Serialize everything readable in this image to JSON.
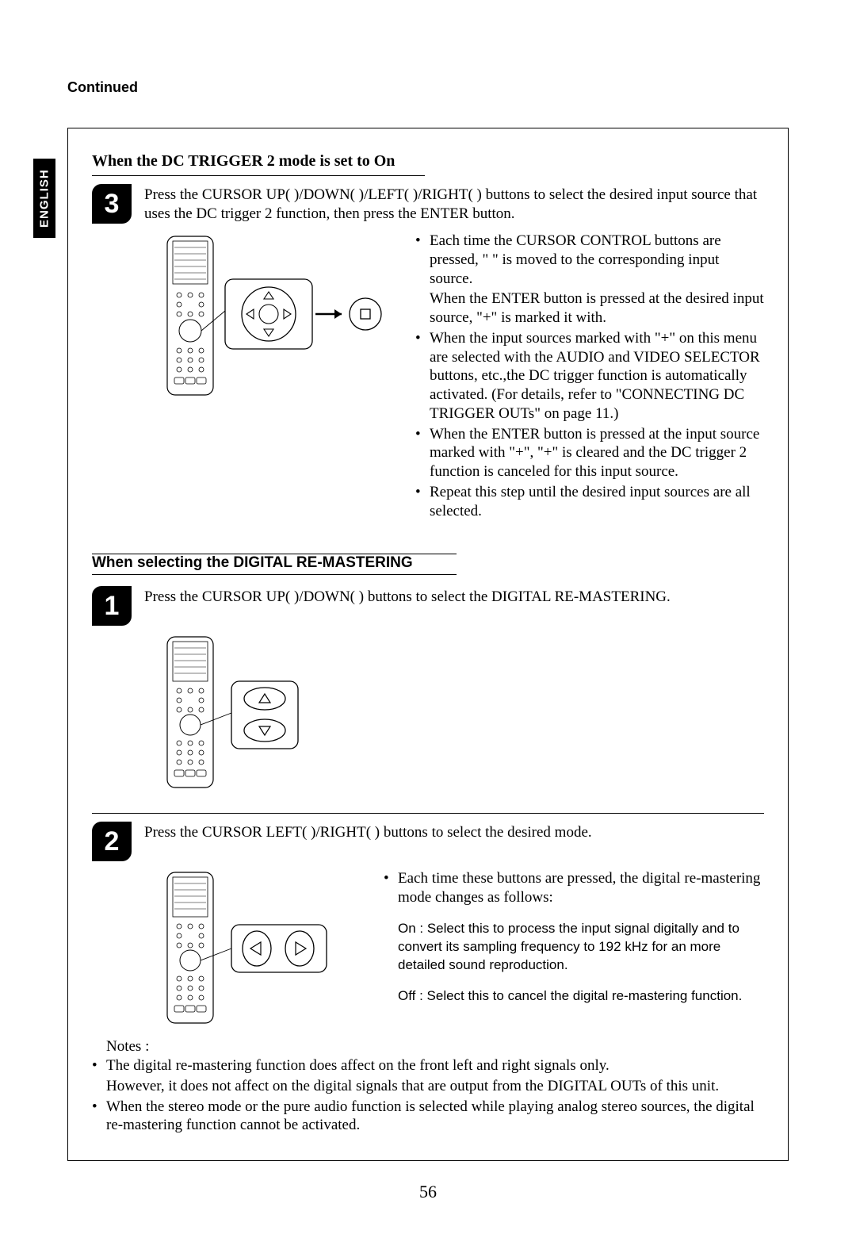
{
  "header": {
    "continued": "Continued",
    "language_tab": "ENGLISH"
  },
  "section_a": {
    "heading": "When the DC TRIGGER 2 mode is set to On",
    "step3": {
      "number": "3",
      "text": "Press the CURSOR UP(    )/DOWN(    )/LEFT(    )/RIGHT(    ) buttons to select the desired input source that uses the DC trigger 2 function, then press the ENTER button."
    },
    "bullets": {
      "b1": "Each time the CURSOR CONTROL buttons are pressed, \"    \" is moved to the corresponding input source.",
      "b1a": "When the ENTER button is pressed at the desired input source, \"+\" is marked it with.",
      "b2": "When the input sources marked with \"+\" on this menu are selected with the AUDIO and VIDEO SELECTOR buttons, etc.,the DC trigger function is automatically activated. (For details, refer to \"CONNECTING DC TRIGGER OUTs\" on page 11.)",
      "b3": "When the ENTER button is pressed at the input source marked with \"+\", \"+\" is cleared and the DC trigger 2 function is canceled for this input source.",
      "b4": "Repeat this step until the desired input sources are all selected."
    }
  },
  "section_b": {
    "heading": "When selecting the DIGITAL RE-MASTERING",
    "step1": {
      "number": "1",
      "text": "Press the CURSOR UP(    )/DOWN(    ) buttons to select the DIGITAL RE-MASTERING."
    },
    "step2": {
      "number": "2",
      "text": "Press the CURSOR LEFT(    )/RIGHT(    ) buttons to select the desired mode.",
      "b1": "Each time these buttons are pressed, the digital re-mastering mode changes as follows:",
      "mode_on": "On : Select this to process the input signal digitally and to convert its sampling frequency to 192 kHz for an more detailed sound reproduction.",
      "mode_off": "Off : Select this to cancel the digital re-mastering function."
    },
    "notes_label": "Notes :",
    "note1": "The digital re-mastering function does affect on the front left and right signals only.",
    "note1a": "However, it does not affect on the digital signals that are output from the DIGITAL OUTs of this unit.",
    "note2": "When the stereo mode or the pure audio function is selected while playing analog stereo sources, the digital re-mastering function cannot be activated."
  },
  "page_number": "56"
}
